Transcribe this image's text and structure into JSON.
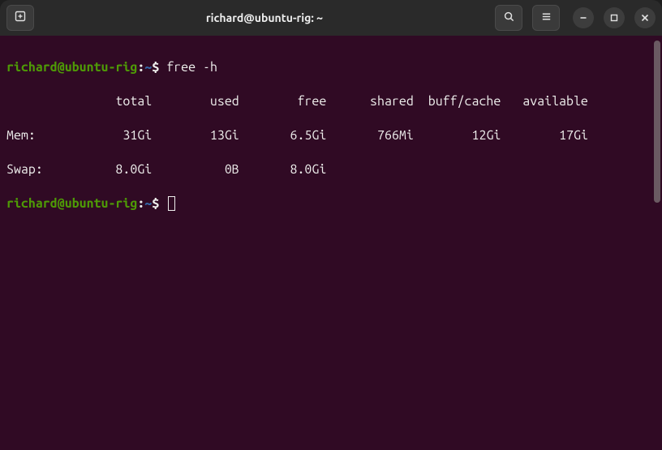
{
  "window": {
    "title": "richard@ubuntu-rig: ~"
  },
  "prompt": {
    "user": "richard",
    "at": "@",
    "host": "ubuntu-rig",
    "colon": ":",
    "tilde": "~",
    "dollar": "$"
  },
  "command": "free -h",
  "headers": {
    "total": "total",
    "used": "used",
    "free": "free",
    "shared": "shared",
    "buffcache": "buff/cache",
    "available": "available"
  },
  "mem": {
    "label": "Mem:",
    "total": "31Gi",
    "used": "13Gi",
    "free": "6.5Gi",
    "shared": "766Mi",
    "buffcache": "12Gi",
    "available": "17Gi"
  },
  "swap": {
    "label": "Swap:",
    "total": "8.0Gi",
    "used": "0B",
    "free": "8.0Gi"
  }
}
